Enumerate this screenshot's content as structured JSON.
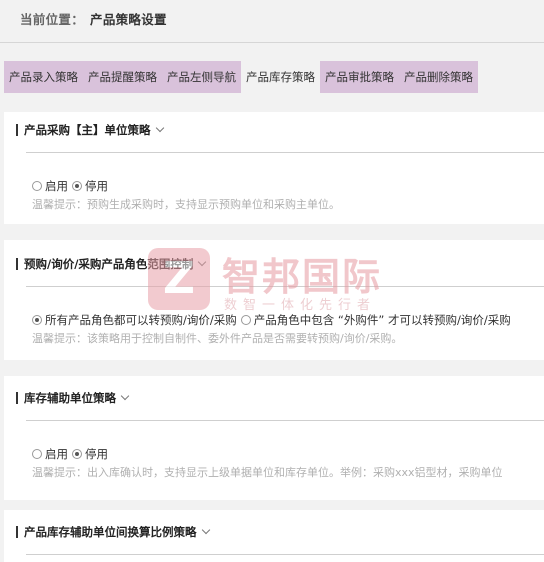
{
  "breadcrumb": {
    "label": "当前位置：",
    "current": "产品策略设置"
  },
  "tabs": [
    {
      "label": "产品录入策略"
    },
    {
      "label": "产品提醒策略"
    },
    {
      "label": "产品左侧导航"
    },
    {
      "label": "产品库存策略",
      "active": true
    },
    {
      "label": "产品审批策略"
    },
    {
      "label": "产品删除策略"
    }
  ],
  "sections": [
    {
      "title": "产品采购【主】单位策略",
      "options": [
        {
          "label": "启用",
          "checked": false
        },
        {
          "label": "停用",
          "checked": true
        }
      ],
      "hint": "温馨提示：预购生成采购时，支持显示预购单位和采购主单位。"
    },
    {
      "title": "预购/询价/采购产品角色范围控制",
      "options": [
        {
          "label": "所有产品角色都可以转预购/询价/采购",
          "checked": true
        },
        {
          "label": "产品角色中包含 “外购件” 才可以转预购/询价/采购",
          "checked": false
        }
      ],
      "hint": "温馨提示：该策略用于控制自制件、委外件产品是否需要转预购/询价/采购。"
    },
    {
      "title": "库存辅助单位策略",
      "options": [
        {
          "label": "启用",
          "checked": false
        },
        {
          "label": "停用",
          "checked": true
        }
      ],
      "hint": "温馨提示：出入库确认时，支持显示上级单据单位和库存单位。举例：采购xxx铝型材，采购单位"
    },
    {
      "title": "产品库存辅助单位间换算比例策略"
    }
  ],
  "watermark": {
    "name": "智邦国际",
    "slogan": "数智一体化先行者"
  }
}
